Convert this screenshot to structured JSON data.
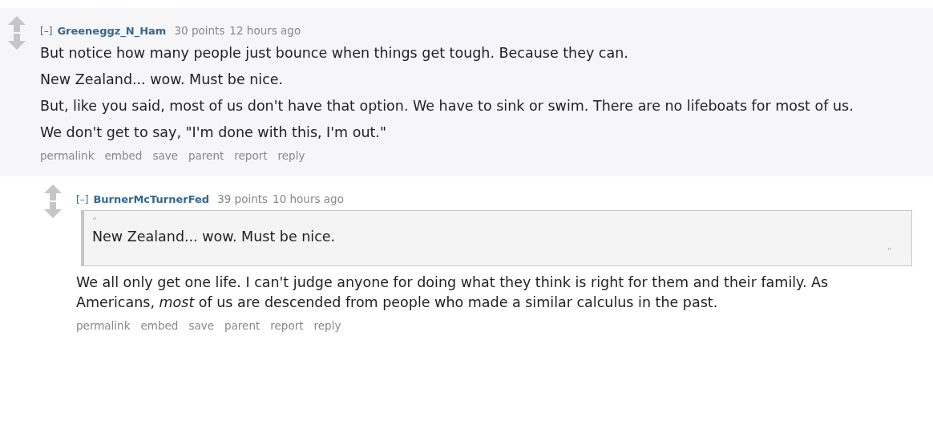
{
  "comment": {
    "collapse": "[–]",
    "author": "Greeneggz_N_Ham",
    "points": "30 points",
    "time": "12 hours ago",
    "paragraphs": [
      "But notice how many people just bounce when things get tough. Because they can.",
      "New Zealand... wow. Must be nice.",
      "But, like you said, most of us don't have that option. We have to sink or swim. There are no lifeboats for most of us.",
      "We don't get to say, \"I'm done with this, I'm out.\""
    ],
    "actions": [
      "permalink",
      "embed",
      "save",
      "parent",
      "report",
      "reply"
    ],
    "reply": {
      "collapse": "[–]",
      "author": "BurnerMcTurnerFed",
      "points": "39 points",
      "time": "10 hours ago",
      "quote": {
        "open_mark": "“",
        "text": "New Zealand... wow. Must be nice.",
        "close_mark": "”"
      },
      "paragraphs": [
        "We all only get one life. I can't judge anyone for doing what they think is right for them and their family. As Americans, *most* of us are descended from people who made a similar calculus in the past."
      ],
      "actions": [
        "permalink",
        "embed",
        "save",
        "parent",
        "report",
        "reply"
      ]
    }
  }
}
